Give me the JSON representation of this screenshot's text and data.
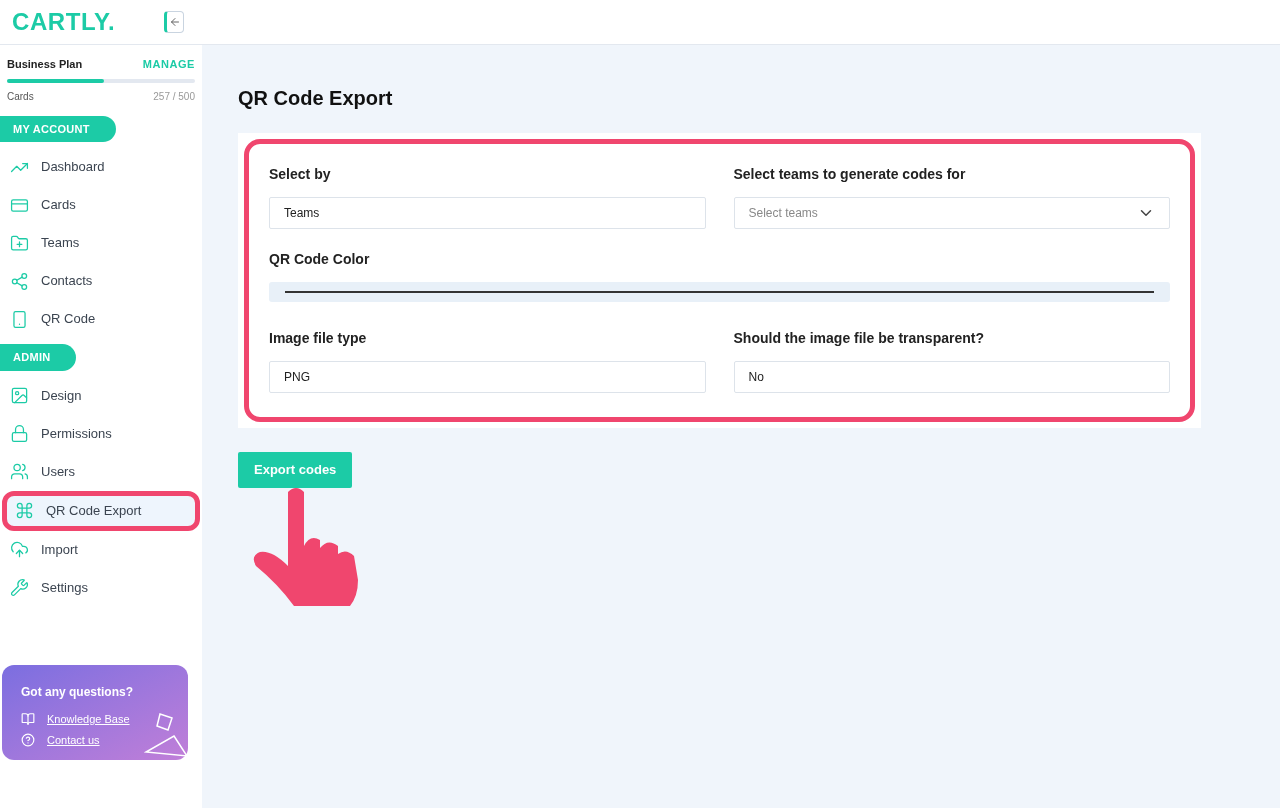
{
  "logo": "CARTLY.",
  "plan": {
    "name": "Business Plan",
    "action": "MANAGE",
    "label": "Cards",
    "reading": "257 / 500",
    "level": 0.514
  },
  "sections": [
    {
      "title": "MY ACCOUNT",
      "items": [
        {
          "label": "Dashboard",
          "selected": false
        },
        {
          "label": "Cards",
          "selected": false
        },
        {
          "label": "Teams",
          "selected": false
        },
        {
          "label": "Contacts",
          "selected": false
        },
        {
          "label": "QR Code",
          "selected": false
        }
      ]
    },
    {
      "title": "ADMIN",
      "items": [
        {
          "label": "Design",
          "selected": false
        },
        {
          "label": "Permissions",
          "selected": false
        },
        {
          "label": "Users",
          "selected": false
        },
        {
          "label": "QR Code Export",
          "selected": true
        },
        {
          "label": "Import",
          "selected": false
        },
        {
          "label": "Settings",
          "selected": false
        }
      ]
    }
  ],
  "help": {
    "title": "Got any questions?",
    "links": [
      {
        "label": "Knowledge Base"
      },
      {
        "label": "Contact us"
      }
    ]
  },
  "page_title": "QR Code Export",
  "form": {
    "select_by": {
      "label": "Select by",
      "value": "Teams"
    },
    "teams": {
      "label": "Select teams to generate codes for",
      "placeholder": "Select teams"
    },
    "color": {
      "label": "QR Code Color"
    },
    "file_type": {
      "label": "Image file type",
      "value": "PNG"
    },
    "transparent": {
      "label": "Should the image file be transparent?",
      "value": "No"
    }
  },
  "export_button": "Export codes"
}
